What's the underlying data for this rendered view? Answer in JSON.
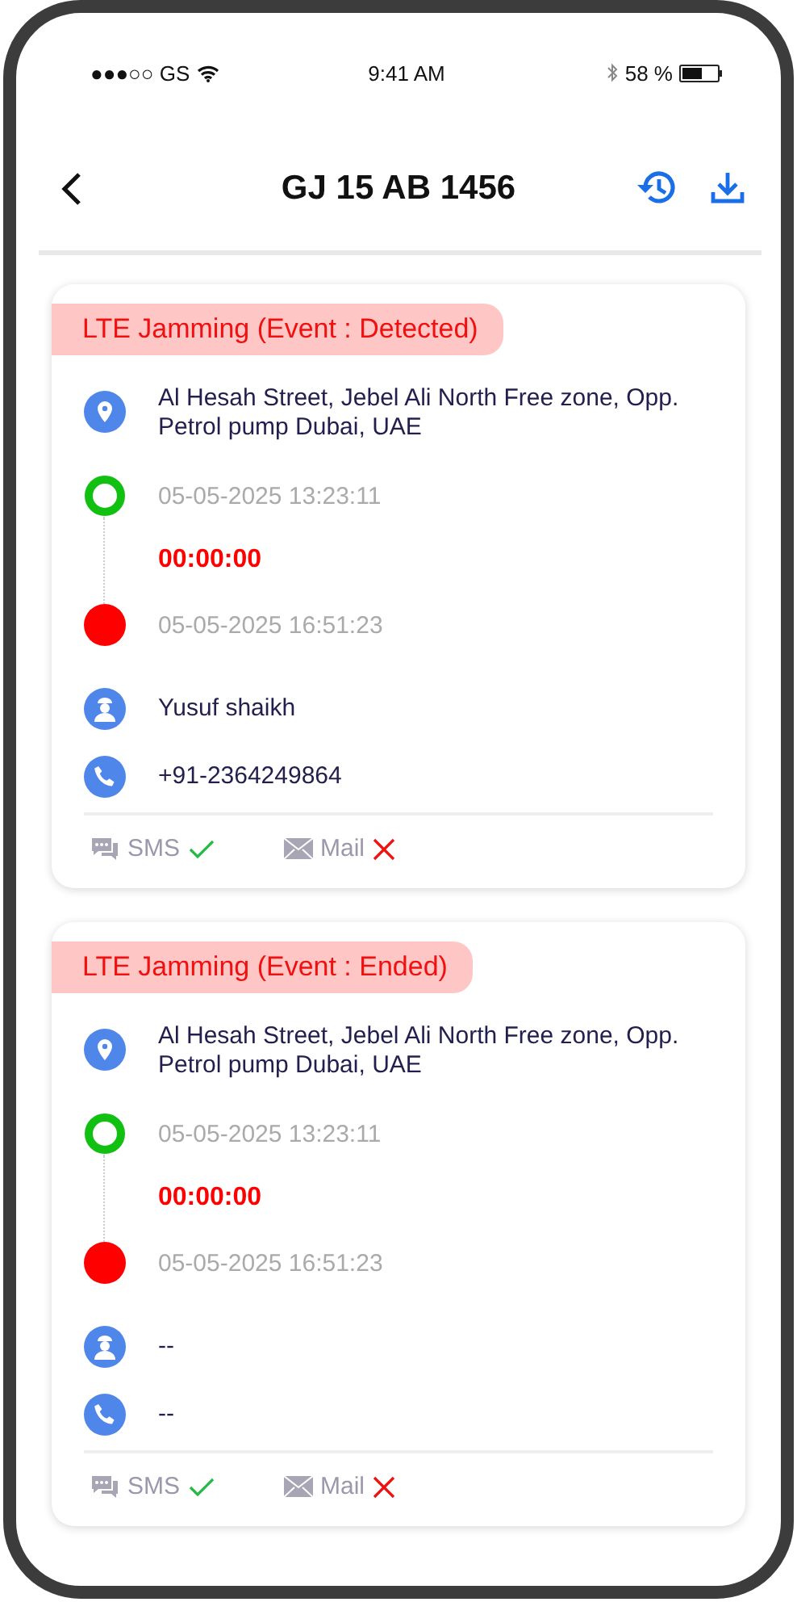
{
  "status_bar": {
    "carrier": "●●●○○ GS",
    "time": "9:41 AM",
    "battery": "58 %"
  },
  "header": {
    "title": "GJ 15 AB 1456"
  },
  "events": [
    {
      "title": "LTE Jamming (Event : Detected)",
      "address": "Al Hesah Street, Jebel Ali North Free zone,  Opp. Petrol pump Dubai, UAE",
      "start": "05-05-2025  13:23:11",
      "duration": "00:00:00",
      "end": "05-05-2025 16:51:23",
      "driver": "Yusuf shaikh",
      "phone": "+91-2364249864",
      "notifications": [
        {
          "kind": "sms",
          "label": "SMS",
          "sent": true
        },
        {
          "kind": "mail",
          "label": "Mail",
          "sent": false
        }
      ]
    },
    {
      "title": "LTE Jamming (Event : Ended)",
      "address": "Al Hesah Street, Jebel Ali North Free zone,  Opp. Petrol pump Dubai, UAE",
      "start": "05-05-2025  13:23:11",
      "duration": "00:00:00",
      "end": "05-05-2025 16:51:23",
      "driver": "--",
      "phone": "--",
      "notifications": [
        {
          "kind": "sms",
          "label": "SMS",
          "sent": true
        },
        {
          "kind": "mail",
          "label": "Mail",
          "sent": false
        }
      ]
    }
  ]
}
